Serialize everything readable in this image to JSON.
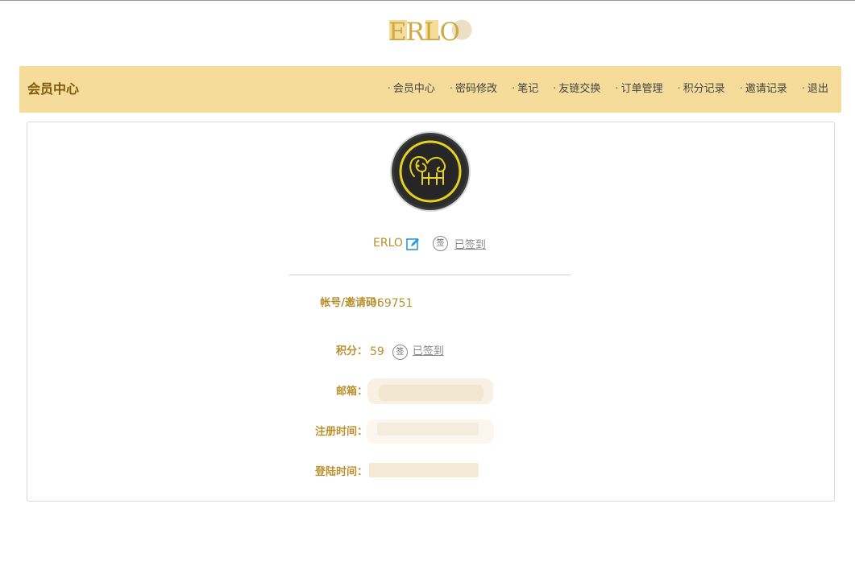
{
  "logo": {
    "text": "ERLO"
  },
  "header": {
    "title": "会员中心"
  },
  "nav": {
    "bullet": "·",
    "items": [
      "会员中心",
      "密码修改",
      "笔记",
      "友链交换",
      "订单管理",
      "积分记录",
      "邀请记录",
      "退出"
    ]
  },
  "profile": {
    "avatar_icon": "elephant-icon",
    "username": "ERLO",
    "sign_badge": "签",
    "signed_text": "已签到"
  },
  "info": {
    "account_label": "帐号/邀请码：",
    "account_value": "069751",
    "points_label": "积分：",
    "points_value": "59",
    "email_label": "邮箱：",
    "register_label": "注册时间：",
    "login_label": "登陆时间："
  },
  "colors": {
    "header_bg": "#f6dc9a",
    "accent": "#b8902e",
    "title": "#7f5a0b"
  }
}
